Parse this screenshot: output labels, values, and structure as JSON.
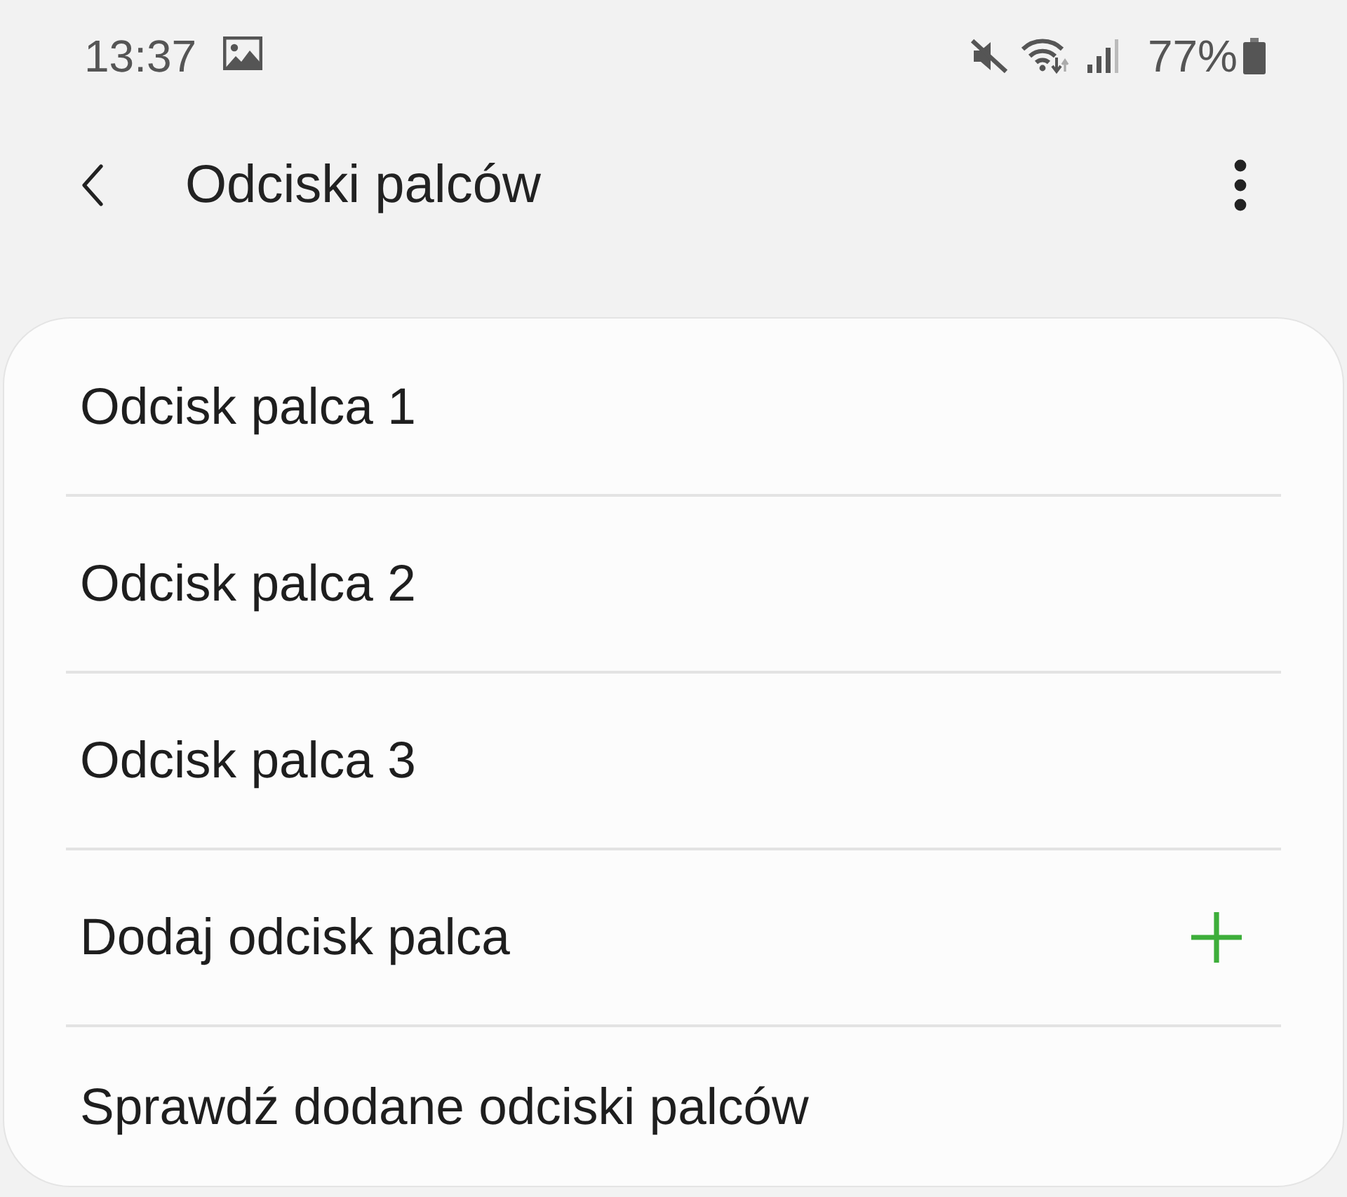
{
  "status_bar": {
    "time": "13:37",
    "battery": "77%"
  },
  "header": {
    "title": "Odciski palców"
  },
  "list": {
    "items": [
      {
        "label": "Odcisk palca 1",
        "kind": "plain"
      },
      {
        "label": "Odcisk palca 2",
        "kind": "plain"
      },
      {
        "label": "Odcisk palca 3",
        "kind": "plain"
      },
      {
        "label": "Dodaj odcisk palca",
        "kind": "add"
      },
      {
        "label": "Sprawdź dodane odciski palców",
        "kind": "plain"
      }
    ]
  }
}
